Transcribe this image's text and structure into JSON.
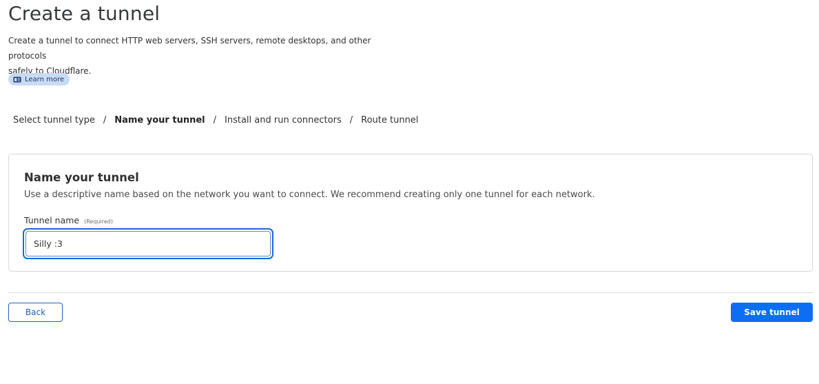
{
  "header": {
    "title": "Create a tunnel",
    "description_line1": "Create a tunnel to connect HTTP web servers, SSH servers, remote desktops, and other protocols",
    "description_line2": "safely to Cloudflare.",
    "learn_more": {
      "label": "Learn more",
      "icon": "book-icon"
    }
  },
  "breadcrumb": {
    "steps": [
      {
        "label": "Select tunnel type",
        "current": false
      },
      {
        "label": "Name your tunnel",
        "current": true
      },
      {
        "label": "Install and run connectors",
        "current": false
      },
      {
        "label": "Route tunnel",
        "current": false
      }
    ],
    "separator": "/"
  },
  "card": {
    "title": "Name your tunnel",
    "description": "Use a descriptive name based on the network you want to connect. We recommend creating only one tunnel for each network.",
    "field": {
      "label": "Tunnel name",
      "required_text": "(Required)",
      "value": "Silly :3"
    }
  },
  "footer": {
    "back_label": "Back",
    "save_label": "Save tunnel"
  },
  "colors": {
    "primary": "#0a6ff2",
    "focus_ring": "#1f67d2",
    "learn_more_bg": "#c7dbf6"
  }
}
